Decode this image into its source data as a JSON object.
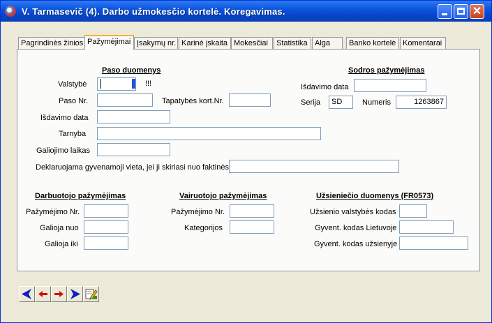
{
  "window": {
    "title": "V. Tarmasevič  (4).  Darbo užmokesčio kortelė. Koregavimas."
  },
  "tabs": [
    "Pagrindinės žinios",
    "Pažymėjimai",
    "Įsakymų nr.",
    "Karinė įskaita",
    "Mokesčiai",
    "Statistika",
    "Alga",
    "Banko kortelė",
    "Komentarai"
  ],
  "active_tab": "Pažymėjimai",
  "passport": {
    "header": "Paso duomenys",
    "state_label": "Valstybė",
    "state_value": "",
    "state_flag": "!!!",
    "passport_no_label": "Paso Nr.",
    "passport_no_value": "",
    "id_card_label": "Tapatybės kort.Nr.",
    "id_card_value": "",
    "issue_date_label": "Išdavimo data",
    "issue_date_value": "",
    "institution_label": "Tarnyba",
    "institution_value": "",
    "validity_label": "Galiojimo laikas",
    "validity_value": "",
    "residence_label": "Deklaruojama gyvenamoji vieta, jei ji skiriasi nuo faktinės",
    "residence_value": ""
  },
  "sodra": {
    "header": "Sodros pažymėjimas",
    "issue_date_label": "Išdavimo data",
    "issue_date_value": "",
    "series_label": "Serija",
    "series_value": "SD",
    "number_label": "Numeris",
    "number_value": "1263867"
  },
  "employee_cert": {
    "header": "Darbuotojo pažymėjimas",
    "cert_no_label": "Pažymėjimo Nr.",
    "cert_no_value": "",
    "valid_from_label": "Galioja nuo",
    "valid_from_value": "",
    "valid_to_label": "Galioja iki",
    "valid_to_value": ""
  },
  "driver_license": {
    "header": "Vairuotojo pažymėjimas",
    "cert_no_label": "Pažymėjimo Nr.",
    "cert_no_value": "",
    "categories_label": "Kategorijos",
    "categories_value": ""
  },
  "foreigner": {
    "header": "Užsieniečio duomenys (FR0573)",
    "country_code_label": "Užsienio valstybės kodas",
    "country_code_value": "",
    "lt_code_label": "Gyvent. kodas Lietuvoje",
    "lt_code_value": "",
    "foreign_code_label": "Gyvent. kodas užsienyje",
    "foreign_code_value": ""
  },
  "navigation": {
    "icons": [
      "first-record-icon",
      "previous-record-icon",
      "next-record-icon",
      "last-record-icon",
      "edit-record-icon"
    ],
    "colors": {
      "arrow_blue": "#1020C0",
      "arrow_red": "#D01010"
    }
  }
}
